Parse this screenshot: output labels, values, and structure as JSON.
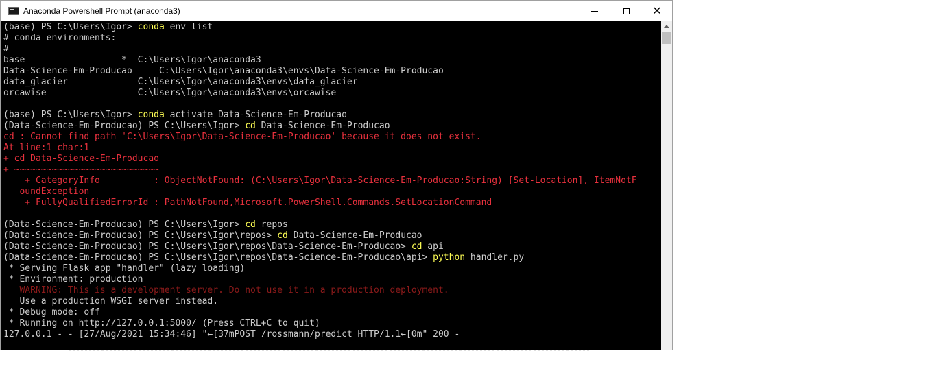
{
  "window": {
    "title": "Anaconda Powershell Prompt (anaconda3)",
    "icon": "console-icon"
  },
  "colors": {
    "console_bg": "#000000",
    "text": "#cccccc",
    "command": "#f9f1a5",
    "error": "#e8313d",
    "warning": "#8b1a1a"
  },
  "console": {
    "lines": [
      [
        {
          "t": "(base) PS C:\\Users\\Igor> ",
          "c": ""
        },
        {
          "t": "conda",
          "c": "yellow2"
        },
        {
          "t": " env list",
          "c": ""
        }
      ],
      [
        {
          "t": "# conda environments:",
          "c": ""
        }
      ],
      [
        {
          "t": "#",
          "c": ""
        }
      ],
      [
        {
          "t": "base                  *  C:\\Users\\Igor\\anaconda3",
          "c": ""
        }
      ],
      [
        {
          "t": "Data-Science-Em-Producao     C:\\Users\\Igor\\anaconda3\\envs\\Data-Science-Em-Producao",
          "c": ""
        }
      ],
      [
        {
          "t": "data_glacier             C:\\Users\\Igor\\anaconda3\\envs\\data_glacier",
          "c": ""
        }
      ],
      [
        {
          "t": "orcawise                 C:\\Users\\Igor\\anaconda3\\envs\\orcawise",
          "c": ""
        }
      ],
      [
        {
          "t": "",
          "c": ""
        }
      ],
      [
        {
          "t": "(base) PS C:\\Users\\Igor> ",
          "c": ""
        },
        {
          "t": "conda",
          "c": "yellow2"
        },
        {
          "t": " activate Data-Science-Em-Producao",
          "c": ""
        }
      ],
      [
        {
          "t": "(Data-Science-Em-Producao) PS C:\\Users\\Igor> ",
          "c": ""
        },
        {
          "t": "cd",
          "c": "yellow2"
        },
        {
          "t": " Data-Science-Em-Producao",
          "c": ""
        }
      ],
      [
        {
          "t": "cd : Cannot find path 'C:\\Users\\Igor\\Data-Science-Em-Producao' because it does not exist.",
          "c": "red"
        }
      ],
      [
        {
          "t": "At line:1 char:1",
          "c": "red"
        }
      ],
      [
        {
          "t": "+ cd Data-Science-Em-Producao",
          "c": "red"
        }
      ],
      [
        {
          "t": "+ ~~~~~~~~~~~~~~~~~~~~~~~~~~~",
          "c": "red"
        }
      ],
      [
        {
          "t": "    + CategoryInfo          : ObjectNotFound: (C:\\Users\\Igor\\Data-Science-Em-Producao:String) [Set-Location], ItemNotF",
          "c": "red"
        }
      ],
      [
        {
          "t": "   oundException",
          "c": "red"
        }
      ],
      [
        {
          "t": "    + FullyQualifiedErrorId : PathNotFound,Microsoft.PowerShell.Commands.SetLocationCommand",
          "c": "red"
        }
      ],
      [
        {
          "t": "",
          "c": ""
        }
      ],
      [
        {
          "t": "(Data-Science-Em-Producao) PS C:\\Users\\Igor> ",
          "c": ""
        },
        {
          "t": "cd",
          "c": "yellow2"
        },
        {
          "t": " repos",
          "c": ""
        }
      ],
      [
        {
          "t": "(Data-Science-Em-Producao) PS C:\\Users\\Igor\\repos> ",
          "c": ""
        },
        {
          "t": "cd",
          "c": "yellow2"
        },
        {
          "t": " Data-Science-Em-Producao",
          "c": ""
        }
      ],
      [
        {
          "t": "(Data-Science-Em-Producao) PS C:\\Users\\Igor\\repos\\Data-Science-Em-Producao> ",
          "c": ""
        },
        {
          "t": "cd",
          "c": "yellow2"
        },
        {
          "t": " api",
          "c": ""
        }
      ],
      [
        {
          "t": "(Data-Science-Em-Producao) PS C:\\Users\\Igor\\repos\\Data-Science-Em-Producao\\api> ",
          "c": ""
        },
        {
          "t": "python",
          "c": "yellow2"
        },
        {
          "t": " handler.py",
          "c": ""
        }
      ],
      [
        {
          "t": " * Serving Flask app \"handler\" (lazy loading)",
          "c": ""
        }
      ],
      [
        {
          "t": " * Environment: production",
          "c": ""
        }
      ],
      [
        {
          "t": "   WARNING: This is a development server. Do not use it in a production deployment.",
          "c": "dred"
        }
      ],
      [
        {
          "t": "   Use a production WSGI server instead.",
          "c": ""
        }
      ],
      [
        {
          "t": " * Debug mode: off",
          "c": ""
        }
      ],
      [
        {
          "t": " * Running on http://127.0.0.1:5000/ (Press CTRL+C to quit)",
          "c": ""
        }
      ],
      [
        {
          "t": "127.0.0.1 - - [27/Aug/2021 15:34:46] \"←[37mPOST /rossmann/predict HTTP/1.1←[0m\" 200 -",
          "c": ""
        }
      ]
    ]
  }
}
